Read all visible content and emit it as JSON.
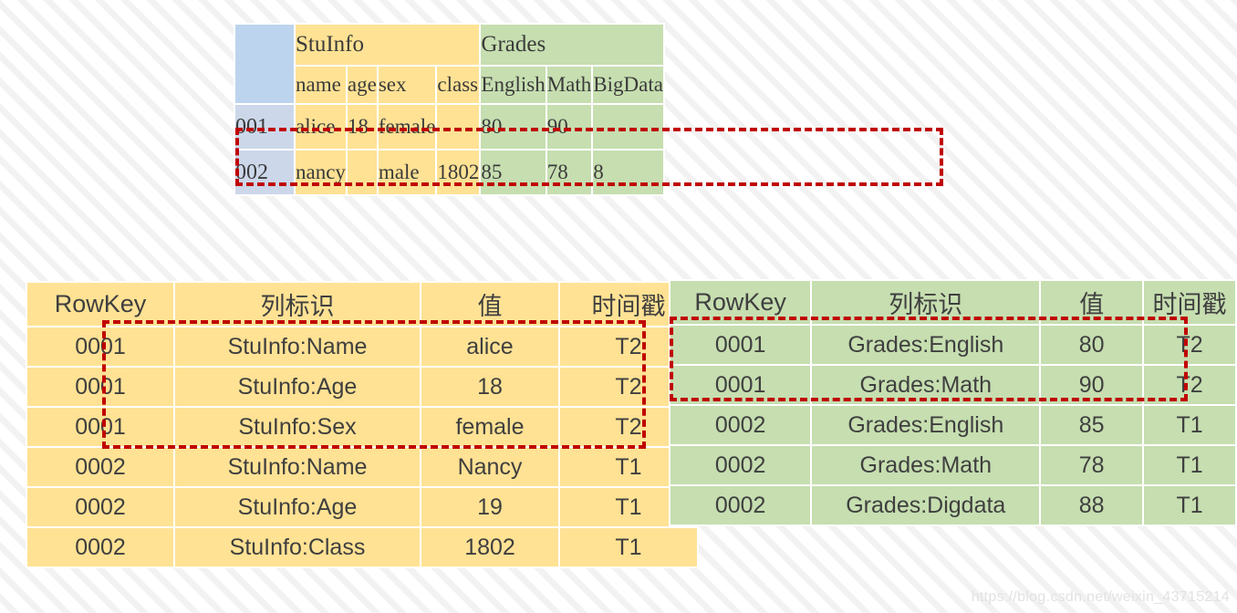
{
  "logical_table": {
    "name": "hbase-logical-view-table",
    "column_families": [
      {
        "label": "StuInfo",
        "span": 4,
        "theme": "yellow"
      },
      {
        "label": "Grades",
        "span": 3,
        "theme": "green"
      }
    ],
    "column_qualifiers": [
      {
        "label": "name",
        "theme": "yellow"
      },
      {
        "label": "age",
        "theme": "yellow"
      },
      {
        "label": "sex",
        "theme": "yellow"
      },
      {
        "label": "class",
        "theme": "yellow"
      },
      {
        "label": "English",
        "theme": "green"
      },
      {
        "label": "Math",
        "theme": "green"
      },
      {
        "label": "BigData",
        "theme": "green"
      }
    ],
    "rows": [
      {
        "rowkey": "001",
        "cells": [
          {
            "value": "alice",
            "theme": "yellow"
          },
          {
            "value": "18",
            "theme": "yellow"
          },
          {
            "value": "female",
            "theme": "yellow"
          },
          {
            "value": "",
            "theme": "yellow"
          },
          {
            "value": "80",
            "theme": "green"
          },
          {
            "value": "90",
            "theme": "green"
          },
          {
            "value": "",
            "theme": "green"
          }
        ]
      },
      {
        "rowkey": "002",
        "cells": [
          {
            "value": "nancy",
            "theme": "yellow"
          },
          {
            "value": "",
            "theme": "yellow"
          },
          {
            "value": "male",
            "theme": "yellow"
          },
          {
            "value": "1802",
            "theme": "yellow"
          },
          {
            "value": "85",
            "theme": "green"
          },
          {
            "value": "78",
            "theme": "green"
          },
          {
            "value": "8",
            "theme": "green"
          }
        ]
      }
    ]
  },
  "stuinfo_kv_table": {
    "name": "stuinfo-keyvalue-table",
    "headers": {
      "rowkey": "RowKey",
      "column": "列标识",
      "value": "值",
      "timestamp": "时间戳"
    },
    "rows": [
      {
        "rowkey": "0001",
        "column": "StuInfo:Name",
        "value": "alice",
        "timestamp": "T2"
      },
      {
        "rowkey": "0001",
        "column": "StuInfo:Age",
        "value": "18",
        "timestamp": "T2"
      },
      {
        "rowkey": "0001",
        "column": "StuInfo:Sex",
        "value": "female",
        "timestamp": "T2"
      },
      {
        "rowkey": "0002",
        "column": "StuInfo:Name",
        "value": "Nancy",
        "timestamp": "T1"
      },
      {
        "rowkey": "0002",
        "column": "StuInfo:Age",
        "value": "19",
        "timestamp": "T1"
      },
      {
        "rowkey": "0002",
        "column": "StuInfo:Class",
        "value": "1802",
        "timestamp": "T1"
      }
    ]
  },
  "grades_kv_table": {
    "name": "grades-keyvalue-table",
    "headers": {
      "rowkey": "RowKey",
      "column": "列标识",
      "value": "值",
      "timestamp": "时间戳"
    },
    "rows": [
      {
        "rowkey": "0001",
        "column": "Grades:English",
        "value": "80",
        "timestamp": "T2"
      },
      {
        "rowkey": "0001",
        "column": "Grades:Math",
        "value": "90",
        "timestamp": "T2"
      },
      {
        "rowkey": "0002",
        "column": "Grades:English",
        "value": "85",
        "timestamp": "T1"
      },
      {
        "rowkey": "0002",
        "column": "Grades:Math",
        "value": "78",
        "timestamp": "T1"
      },
      {
        "rowkey": "0002",
        "column": "Grades:Digdata",
        "value": "88",
        "timestamp": "T1"
      }
    ]
  },
  "highlights": {
    "color": "#c00000",
    "boxes": [
      {
        "name": "logical-row-001-highlight"
      },
      {
        "name": "stuinfo-row-0001-highlight"
      },
      {
        "name": "grades-row-0001-highlight"
      }
    ]
  },
  "watermark": {
    "text": "https://blog.csdn.net/weixin_43715214"
  },
  "colors": {
    "yellow_cell": "#ffe294",
    "green_cell": "#c6deb0",
    "rowkey_header": "#bdd4ee",
    "rowkey_data": "#ccd7ea",
    "highlight": "#c00000",
    "text": "#3f3f3f"
  }
}
